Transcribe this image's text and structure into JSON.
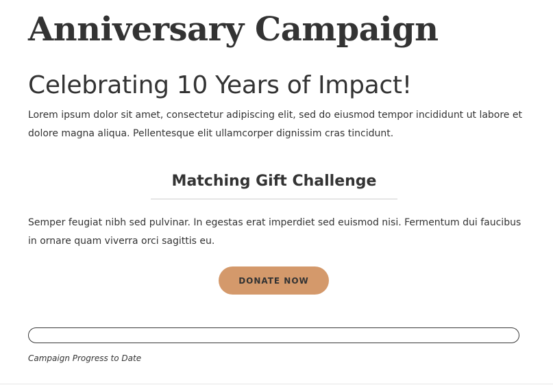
{
  "campaign": {
    "title": "Anniversary Campaign",
    "subtitle": "Celebrating 10 Years of Impact!",
    "intro": "Lorem ipsum dolor sit amet, consectetur adipiscing elit, sed do eiusmod tempor incididunt ut labore et dolore magna aliqua. Pellentesque elit ullamcorper dignissim cras tincidunt."
  },
  "matching": {
    "heading": "Matching Gift Challenge",
    "body": "Semper feugiat nibh sed pulvinar. In egestas erat imperdiet sed euismod nisi. Fermentum dui faucibus in ornare quam viverra orci sagittis eu.",
    "donate_label": "DONATE NOW"
  },
  "progress": {
    "caption": "Campaign Progress to Date",
    "percent": 0
  },
  "colors": {
    "accent": "#d4996b",
    "text": "#333333",
    "divider": "#cccccc",
    "progress_border": "#3a3a3a"
  }
}
